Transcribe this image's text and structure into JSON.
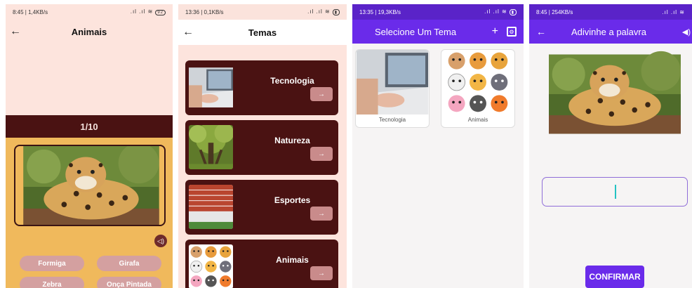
{
  "screen1": {
    "status_time": "8:45 | 1,4KB/s",
    "battery": "92",
    "title": "Animais",
    "counter": "1/10",
    "options": [
      "Formiga",
      "Girafa",
      "Zebra",
      "Onça Pintada"
    ]
  },
  "screen2": {
    "status_time": "13:36 | 0,1KB/s",
    "battery": "",
    "title": "Temas",
    "themes": [
      {
        "label": "Tecnologia",
        "arrow": "→"
      },
      {
        "label": "Natureza",
        "arrow": "→"
      },
      {
        "label": "Esportes",
        "arrow": "→"
      },
      {
        "label": "Animais",
        "arrow": "→"
      }
    ]
  },
  "screen3": {
    "status_time": "13:35 | 19,3KB/s",
    "title": "Selecione Um Tema",
    "add": "+",
    "tiles": [
      {
        "label": "Tecnologia"
      },
      {
        "label": "Animais"
      }
    ]
  },
  "screen4": {
    "status_time": "8:45 | 254KB/s",
    "title": "Adivinhe a palavra",
    "confirm": "CONFIRMAR"
  },
  "colors": {
    "maroon": "#4a1212",
    "peach": "#fde4dd",
    "mustard": "#f0b95c",
    "purple": "#6a2bea"
  }
}
